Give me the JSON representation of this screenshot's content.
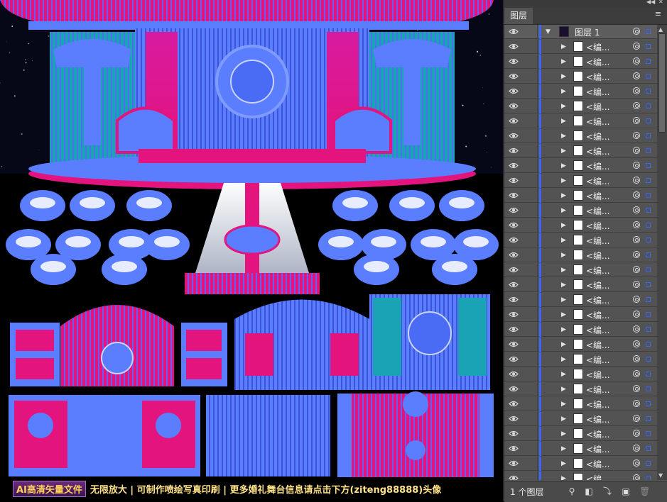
{
  "banner": {
    "tag": "AI高清矢量文件",
    "text": "无限放大 | 可制作喷绘写真印刷 | 更多婚礼舞台信息请点击下方(ziteng88888)头像"
  },
  "layers_panel": {
    "tab_title": "图层",
    "top_layer": {
      "name": "图层 1"
    },
    "rows_name": "<编...",
    "thumb_colors": [
      "#ffffff",
      "#ffffff",
      "#ffffff",
      "#ffffff",
      "#ffffff",
      "#ffffff",
      "#ffffff",
      "#ffffff",
      "#ffffff",
      "#ffffff",
      "#ffffff",
      "#ffffff",
      "#ffffff",
      "#ffffff",
      "#ffffff",
      "#ffffff",
      "#ffffff",
      "#ffffff",
      "#ffffff",
      "#ffffff",
      "#ffffff",
      "#ffffff",
      "#ffffff",
      "#ffffff",
      "#ffffff",
      "#ffffff",
      "#ffffff",
      "#ffffff",
      "#ffffff",
      "#ffffff",
      "#ffffff"
    ],
    "footer_count": "1 个图层"
  },
  "colors": {
    "stage_blue": "#5b7dff",
    "stage_magenta": "#e3147e",
    "teal": "#1aa3b5",
    "panel_bg": "#535353",
    "select_blue": "#3a66ff"
  }
}
